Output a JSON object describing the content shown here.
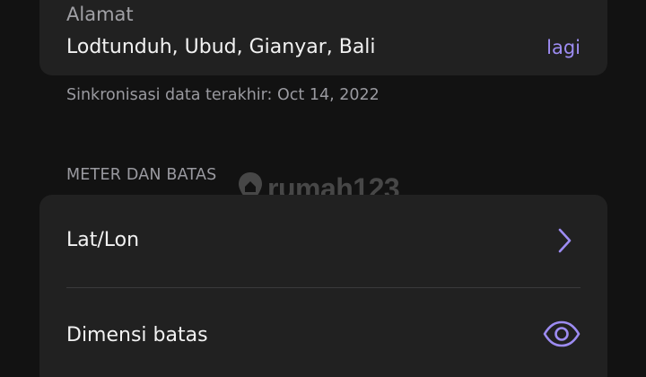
{
  "address": {
    "label": "Alamat",
    "value": "Lodtunduh, Ubud, Gianyar, Bali",
    "more_label": "lagi"
  },
  "sync": {
    "text": "Sinkronisasi data terakhir: Oct 14, 2022"
  },
  "meter_section": {
    "header": "METER DAN BATAS",
    "items": [
      {
        "label": "Lat/Lon",
        "icon": "chevron-right-icon"
      },
      {
        "label": "Dimensi batas",
        "icon": "eye-icon"
      }
    ]
  },
  "watermark": {
    "text": "rumah123"
  },
  "colors": {
    "background": "#121212",
    "card": "#212121",
    "accent": "#9d8cf2",
    "text_primary": "#f2f2f2",
    "text_secondary": "#9a9aa0"
  }
}
